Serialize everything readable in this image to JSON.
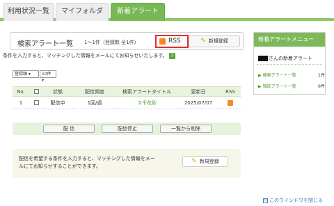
{
  "tabs": [
    {
      "label": "利用状況一覧"
    },
    {
      "label": "マイフォルダ"
    },
    {
      "label": "新着アラート"
    }
  ],
  "alert_header": {
    "title": "検索アラート一覧",
    "count_text": "1～1件（登録数 全1件）",
    "rss_label": "RSS",
    "register_label": "新規登録"
  },
  "description": "条件を入力すると、マッチングした情報をメールにてお知らせいたします。",
  "sort_select": {
    "value": "登録順"
  },
  "per_page_select": {
    "value": "10件"
  },
  "table": {
    "headers": {
      "no": "No.",
      "status": "状態",
      "frequency": "配信頻度",
      "alert_title": "検索アラートタイトル",
      "updated": "更新日",
      "rss": "RSS"
    },
    "rows": [
      {
        "no": "1",
        "status": "配信中",
        "frequency": "1回/週",
        "alert_title": "ス千花砂",
        "updated": "2025/07/07"
      }
    ]
  },
  "actions": {
    "deliver": "配 信",
    "stop": "配信停止",
    "delete": "一覧から削除"
  },
  "hint": {
    "text": "配信を希望する条件を入力すると、マッチングした情報をメールにてお知らせすることができます。",
    "register_label": "新規登録"
  },
  "sidebar": {
    "title": "新着アラートメニュー",
    "user_suffix": "さんの新着アラート",
    "items": [
      {
        "label": "検索アラート一覧",
        "count": "1件"
      },
      {
        "label": "雑誌アラート一覧",
        "count": "0件"
      }
    ]
  },
  "close_window": "このウインドウを閉じる",
  "colors": {
    "accent": "#78b855",
    "rss": "#f08a24",
    "highlight": "#e03030"
  }
}
